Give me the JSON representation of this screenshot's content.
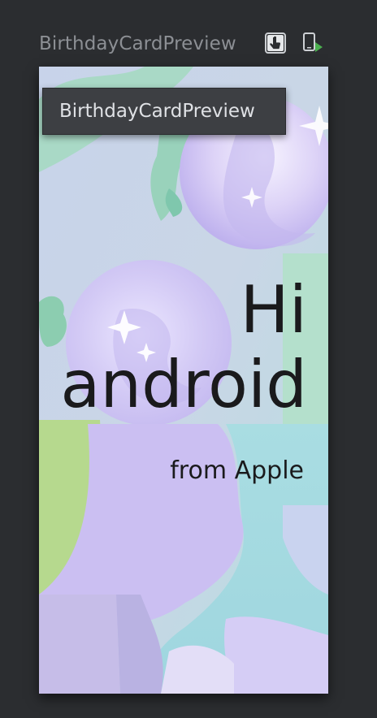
{
  "preview": {
    "title": "BirthdayCardPreview"
  },
  "toolbar": {
    "interactive_mode_icon": "interactive-mode-icon",
    "deploy_to_device_icon": "deploy-to-device-icon"
  },
  "tooltip": {
    "text": "BirthdayCardPreview"
  },
  "card": {
    "greeting_line1": "Hi",
    "greeting_line2": "android",
    "from": "from Apple"
  },
  "colors": {
    "ide_background": "#2b2d30",
    "title_text": "#8c8f94",
    "tooltip_background": "#3d3f43",
    "deploy_accent": "#4caf50",
    "card_text": "#1a1a1c"
  }
}
